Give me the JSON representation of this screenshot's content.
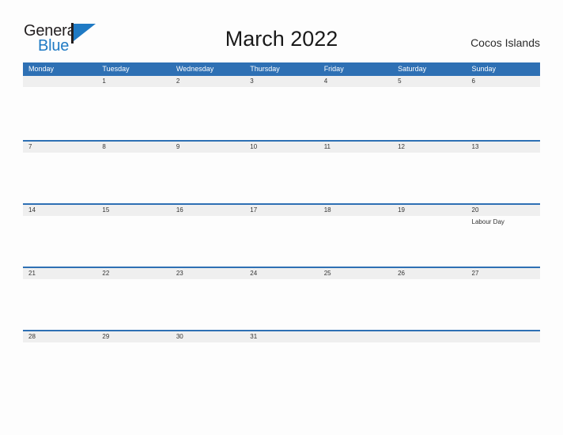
{
  "brand": {
    "name_part1": "General",
    "name_part2": "Blue",
    "mark": "flag-triangle",
    "color_primary": "#1f7ac4",
    "color_text": "#231f20"
  },
  "header": {
    "title": "March 2022",
    "locale": "Cocos Islands"
  },
  "calendar": {
    "month": "March",
    "year": "2022",
    "accent_color": "#2e70b4",
    "date_band_color": "#efefef",
    "weekdays": [
      "Monday",
      "Tuesday",
      "Wednesday",
      "Thursday",
      "Friday",
      "Saturday",
      "Sunday"
    ],
    "weeks": [
      {
        "days": [
          {
            "num": "",
            "event": ""
          },
          {
            "num": "1",
            "event": ""
          },
          {
            "num": "2",
            "event": ""
          },
          {
            "num": "3",
            "event": ""
          },
          {
            "num": "4",
            "event": ""
          },
          {
            "num": "5",
            "event": ""
          },
          {
            "num": "6",
            "event": ""
          }
        ]
      },
      {
        "days": [
          {
            "num": "7",
            "event": ""
          },
          {
            "num": "8",
            "event": ""
          },
          {
            "num": "9",
            "event": ""
          },
          {
            "num": "10",
            "event": ""
          },
          {
            "num": "11",
            "event": ""
          },
          {
            "num": "12",
            "event": ""
          },
          {
            "num": "13",
            "event": ""
          }
        ]
      },
      {
        "days": [
          {
            "num": "14",
            "event": ""
          },
          {
            "num": "15",
            "event": ""
          },
          {
            "num": "16",
            "event": ""
          },
          {
            "num": "17",
            "event": ""
          },
          {
            "num": "18",
            "event": ""
          },
          {
            "num": "19",
            "event": ""
          },
          {
            "num": "20",
            "event": "Labour Day"
          }
        ]
      },
      {
        "days": [
          {
            "num": "21",
            "event": ""
          },
          {
            "num": "22",
            "event": ""
          },
          {
            "num": "23",
            "event": ""
          },
          {
            "num": "24",
            "event": ""
          },
          {
            "num": "25",
            "event": ""
          },
          {
            "num": "26",
            "event": ""
          },
          {
            "num": "27",
            "event": ""
          }
        ]
      },
      {
        "days": [
          {
            "num": "28",
            "event": ""
          },
          {
            "num": "29",
            "event": ""
          },
          {
            "num": "30",
            "event": ""
          },
          {
            "num": "31",
            "event": ""
          },
          {
            "num": "",
            "event": ""
          },
          {
            "num": "",
            "event": ""
          },
          {
            "num": "",
            "event": ""
          }
        ]
      }
    ]
  }
}
